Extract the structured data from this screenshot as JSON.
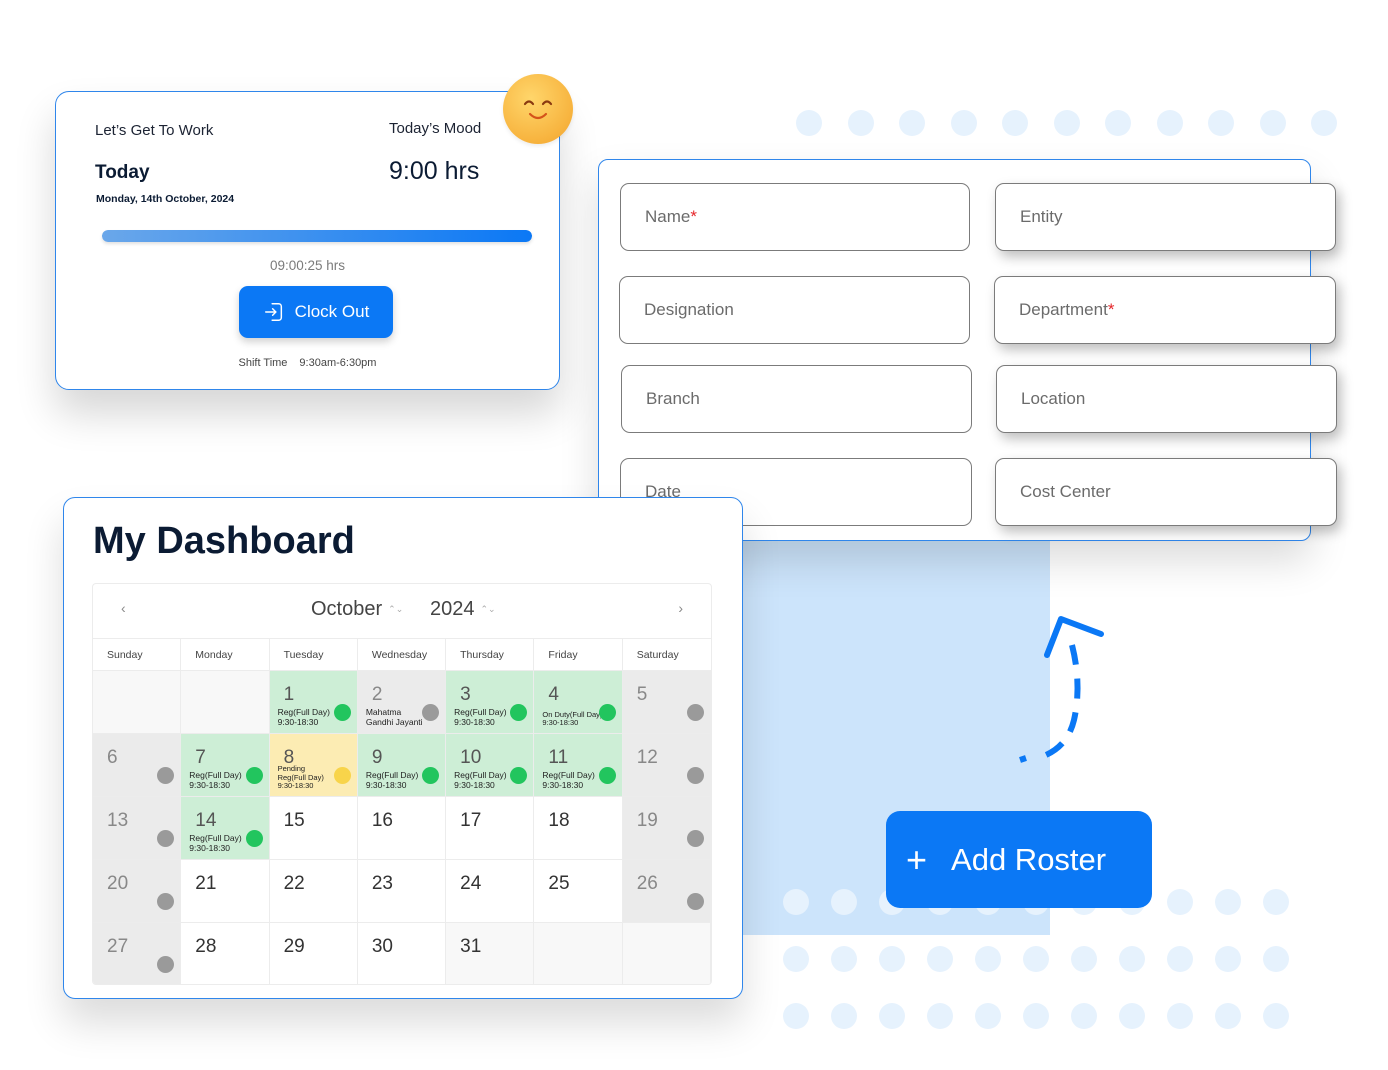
{
  "clock_card": {
    "greeting": "Let’s Get To Work",
    "mood_label": "Today’s Mood",
    "today_label": "Today",
    "date": "Monday, 14th October, 2024",
    "hours": "9:00 hrs",
    "progress_percent": 100,
    "elapsed": "09:00:25 hrs",
    "clock_out_label": "Clock Out",
    "shift_label": "Shift Time",
    "shift_time": "9:30am-6:30pm",
    "mood_icon": "smiley-face-icon"
  },
  "form": {
    "fields": [
      {
        "label": "Name",
        "required": true
      },
      {
        "label": "Entity",
        "required": false
      },
      {
        "label": "Designation",
        "required": false
      },
      {
        "label": "Department",
        "required": true
      },
      {
        "label": "Branch",
        "required": false
      },
      {
        "label": "Location",
        "required": false
      },
      {
        "label": "Date",
        "required": false
      },
      {
        "label": "Cost Center",
        "required": false
      }
    ],
    "required_marker": "*"
  },
  "dashboard": {
    "title": "My Dashboard",
    "calendar": {
      "month": "October",
      "year": "2024",
      "prev_icon": "‹",
      "next_icon": "›",
      "spin_icon": "⌃⌄",
      "weekdays": [
        "Sunday",
        "Monday",
        "Tuesday",
        "Wednesday",
        "Thursday",
        "Friday",
        "Saturday"
      ],
      "cells": [
        {
          "day": "",
          "type": "empty"
        },
        {
          "day": "",
          "type": "empty"
        },
        {
          "day": "1",
          "type": "present",
          "note": [
            "Reg(Full Day)",
            "9:30-18:30"
          ],
          "dot": "green"
        },
        {
          "day": "2",
          "type": "holiday",
          "note": [
            "Mahatma",
            "Gandhi Jayanti"
          ],
          "dot": "gray"
        },
        {
          "day": "3",
          "type": "present",
          "note": [
            "Reg(Full Day)",
            "9:30-18:30"
          ],
          "dot": "green"
        },
        {
          "day": "4",
          "type": "present",
          "note": [
            "On Duty(Full Day)",
            "9:30-18:30"
          ],
          "dot": "green",
          "small": true
        },
        {
          "day": "5",
          "type": "weekend",
          "dot": "gray"
        },
        {
          "day": "6",
          "type": "weekend",
          "dot": "gray"
        },
        {
          "day": "7",
          "type": "present",
          "note": [
            "Reg(Full Day)",
            "9:30-18:30"
          ],
          "dot": "green"
        },
        {
          "day": "8",
          "type": "pending",
          "note": [
            "Pending",
            "Reg(Full Day)",
            "9:30-18:30"
          ],
          "dot": "yellow",
          "small": true
        },
        {
          "day": "9",
          "type": "present",
          "note": [
            "Reg(Full Day)",
            "9:30-18:30"
          ],
          "dot": "green"
        },
        {
          "day": "10",
          "type": "present",
          "note": [
            "Reg(Full Day)",
            "9:30-18:30"
          ],
          "dot": "green"
        },
        {
          "day": "11",
          "type": "present",
          "note": [
            "Reg(Full Day)",
            "9:30-18:30"
          ],
          "dot": "green"
        },
        {
          "day": "12",
          "type": "weekend",
          "dot": "gray"
        },
        {
          "day": "13",
          "type": "weekend",
          "dot": "gray"
        },
        {
          "day": "14",
          "type": "present",
          "note": [
            "Reg(Full Day)",
            "9:30-18:30"
          ],
          "dot": "green"
        },
        {
          "day": "15",
          "type": "normal"
        },
        {
          "day": "16",
          "type": "normal"
        },
        {
          "day": "17",
          "type": "normal"
        },
        {
          "day": "18",
          "type": "normal"
        },
        {
          "day": "19",
          "type": "weekend",
          "dot": "gray"
        },
        {
          "day": "20",
          "type": "weekend",
          "dot": "gray"
        },
        {
          "day": "21",
          "type": "normal"
        },
        {
          "day": "22",
          "type": "normal"
        },
        {
          "day": "23",
          "type": "normal"
        },
        {
          "day": "24",
          "type": "normal"
        },
        {
          "day": "25",
          "type": "normal"
        },
        {
          "day": "26",
          "type": "weekend",
          "dot": "gray"
        },
        {
          "day": "27",
          "type": "weekend",
          "dot": "gray"
        },
        {
          "day": "28",
          "type": "normal"
        },
        {
          "day": "29",
          "type": "normal"
        },
        {
          "day": "30",
          "type": "normal"
        },
        {
          "day": "31",
          "type": "empty-num"
        },
        {
          "day": "",
          "type": "empty"
        },
        {
          "day": "",
          "type": "empty"
        }
      ]
    }
  },
  "add_roster": {
    "label": "Add Roster",
    "icon": "+"
  },
  "colors": {
    "accent": "#0b78f5",
    "border": "#2f86eb",
    "present": "#cdeed6",
    "pending": "#fcecb3",
    "weekend": "#ebebeb",
    "required": "#e5262a"
  }
}
